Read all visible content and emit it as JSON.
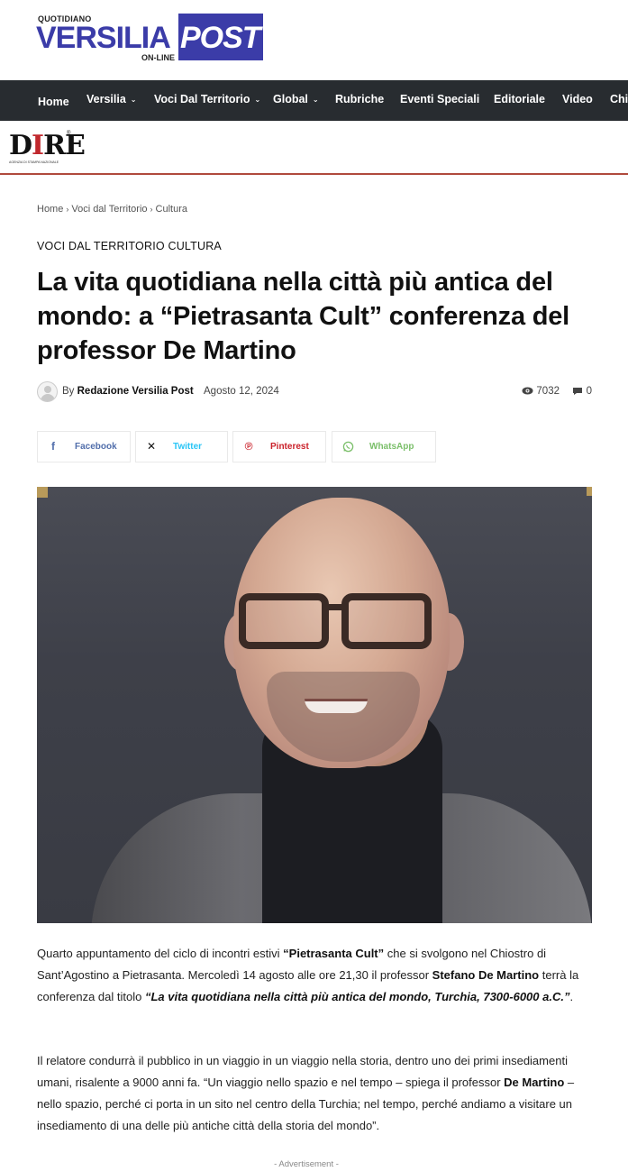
{
  "header": {
    "logo_top": "QUOTIDIANO",
    "logo_main": "VERSILIA",
    "logo_accent": "POST",
    "logo_bottom": "ON-LINE"
  },
  "nav": {
    "items": [
      {
        "label": "Home",
        "dropdown": false
      },
      {
        "label": "Versilia",
        "dropdown": true
      },
      {
        "label": "Voci Dal Territorio",
        "dropdown": true
      },
      {
        "label": "Global",
        "dropdown": true
      },
      {
        "label": "Rubriche",
        "dropdown": false
      },
      {
        "label": "Eventi Speciali",
        "dropdown": false
      },
      {
        "label": "Editoriale",
        "dropdown": false
      },
      {
        "label": "Video",
        "dropdown": false
      },
      {
        "label": "Chi",
        "dropdown": false
      }
    ],
    "chevron": "⌄"
  },
  "partner": {
    "logo": "DIRE",
    "tagline": "AGENZIA DI STAMPA NAZIONALE",
    "reg": "®"
  },
  "breadcrumb": [
    "Home",
    "Voci dal Territorio",
    "Cultura"
  ],
  "category": "VOCI DAL TERRITORIO CULTURA",
  "title": "La vita quotidiana nella città più antica del mondo: a “Pietrasanta Cult” conferenza del professor De Martino",
  "meta": {
    "by": "By",
    "author": "Redazione Versilia Post",
    "date": "Agosto 12, 2024",
    "views": "7032",
    "comments": "0"
  },
  "share": [
    {
      "label": "Facebook",
      "icon": "facebook-icon",
      "color": "#516eab"
    },
    {
      "label": "Twitter",
      "icon": "x-icon",
      "color": "#29c5f6"
    },
    {
      "label": "Pinterest",
      "icon": "pinterest-icon",
      "color": "#ca212a"
    },
    {
      "label": "WhatsApp",
      "icon": "whatsapp-icon",
      "color": "#7bbf6a"
    }
  ],
  "article": {
    "p1": [
      {
        "t": "Quarto appuntamento del ciclo di incontri estivi "
      },
      {
        "t": "“Pietrasanta Cult”",
        "b": true
      },
      {
        "t": " che si svolgono nel Chiostro di Sant’Agostino a Pietrasanta. Mercoledì 14 agosto alle ore 21,30 il professor "
      },
      {
        "t": "Stefano De Martino",
        "b": true
      },
      {
        "t": " terrà la conferenza dal titolo "
      },
      {
        "t": "“La vita quotidiana nella città più antica del mondo, Turchia, 7300-6000 a.C.”",
        "b": true,
        "i": true
      },
      {
        "t": "."
      }
    ],
    "p2": [
      {
        "t": "Il relatore condurrà il pubblico in un viaggio in un viaggio nella storia, dentro uno dei primi insediamenti umani, risalente a 9000 anni fa. “Un viaggio nello spazio e nel tempo – spiega il professor "
      },
      {
        "t": "De Martino",
        "b": true
      },
      {
        "t": " – nello spazio, perché ci porta in un sito nel centro della Turchia; nel tempo, perché andiamo a visitare un insediamento di una delle più antiche città della storia del mondo”."
      }
    ]
  },
  "advertisement": "- Advertisement -"
}
